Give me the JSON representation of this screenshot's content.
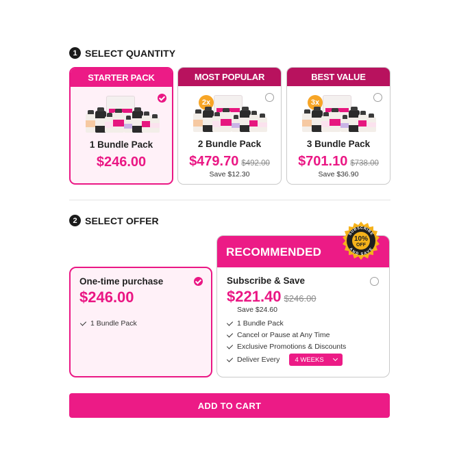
{
  "colors": {
    "accent": "#ec1b86",
    "accent_dark": "#b8125e",
    "badge_orange": "#f7a526",
    "selected_bg": "#fff1f8"
  },
  "step1": {
    "number": "1",
    "title": "SELECT QUANTITY"
  },
  "step2": {
    "number": "2",
    "title": "SELECT OFFER"
  },
  "quantity_options": [
    {
      "header": "STARTER PACK",
      "name": "1 Bundle Pack",
      "price": "$246.00",
      "old_price": "",
      "save": "",
      "badge": "",
      "selected": true
    },
    {
      "header": "MOST POPULAR",
      "name": "2 Bundle Pack",
      "price": "$479.70",
      "old_price": "$492.00",
      "save": "Save $12.30",
      "badge": "2x",
      "selected": false
    },
    {
      "header": "BEST VALUE",
      "name": "3 Bundle Pack",
      "price": "$701.10",
      "old_price": "$738.00",
      "save": "Save $36.90",
      "badge": "3x",
      "selected": false
    }
  ],
  "offers": {
    "one_time": {
      "title": "One-time purchase",
      "price": "$246.00",
      "features": [
        "1 Bundle Pack"
      ],
      "selected": true
    },
    "subscribe": {
      "header": "RECOMMENDED",
      "title": "Subscribe & Save",
      "price": "$221.40",
      "old_price": "$246.00",
      "save": "Save $24.60",
      "features": [
        "1 Bundle Pack",
        "Cancel or Pause at Any Time",
        "Exclusive Promotions & Discounts"
      ],
      "deliver_label": "Deliver Every",
      "deliver_value": "4 WEEKS",
      "selected": false,
      "seal": {
        "top_text": "SUBSCRIBE",
        "main": "10%",
        "sub": "OFF",
        "bottom_text": "AND SAVE"
      }
    }
  },
  "cart": {
    "label": "ADD TO CART"
  }
}
